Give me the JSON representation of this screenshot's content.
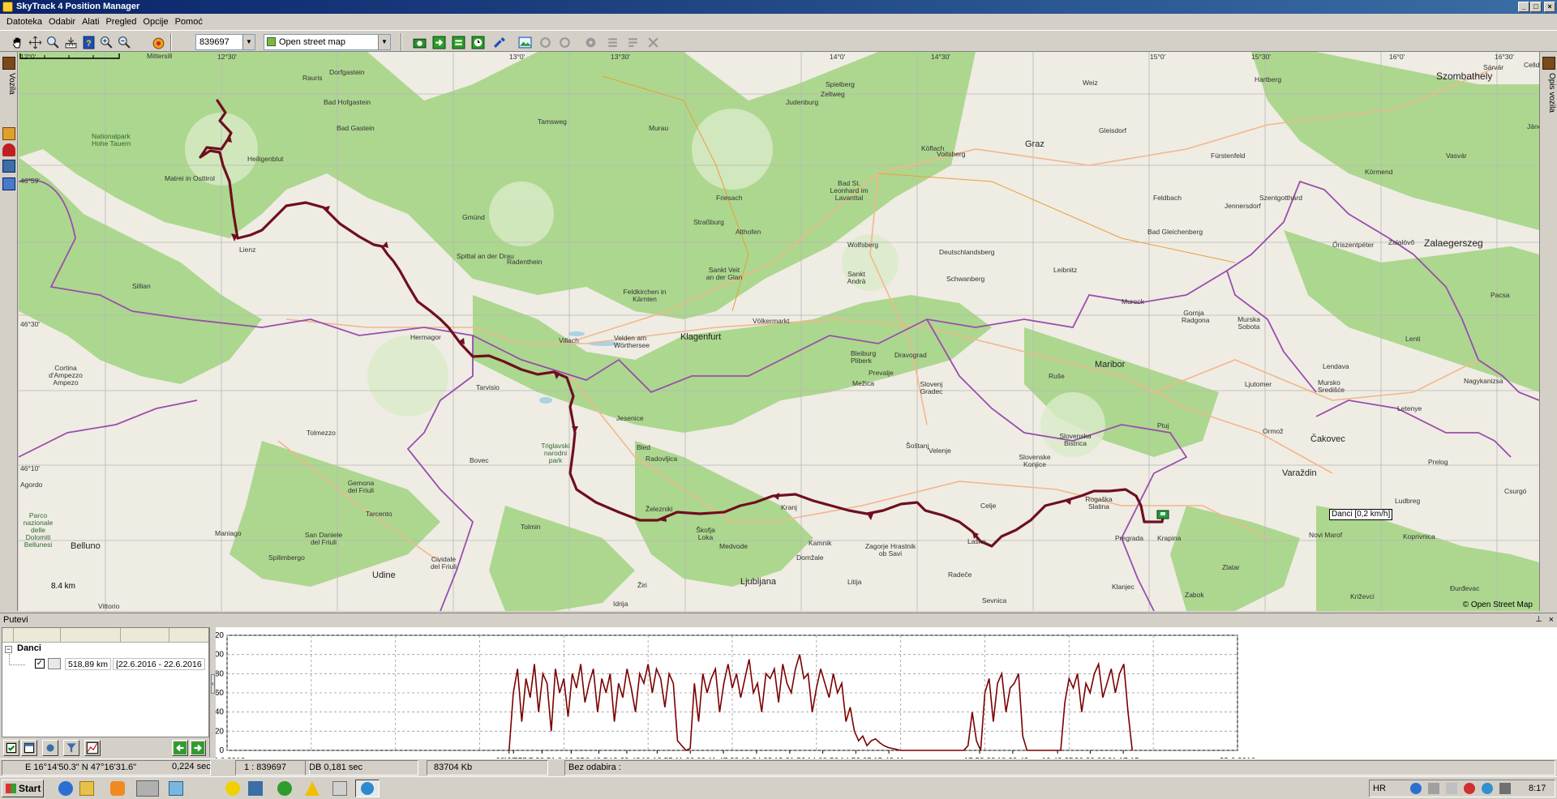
{
  "window": {
    "title": "SkyTrack 4 Position Manager"
  },
  "menu": [
    "Datoteka",
    "Odabir",
    "Alati",
    "Pregled",
    "Opcije",
    "Pomoć"
  ],
  "toolbar": {
    "scale_prefix": "1 :",
    "scale_value": "839697",
    "map_source": "Open street map"
  },
  "left_tabs": {
    "vehicles": "Vozila"
  },
  "right_tabs": {
    "vehicle_desc": "Opis vozila"
  },
  "map": {
    "grid_labels": [
      "12°0'",
      "12°30'",
      "13°0'",
      "13°30'",
      "14°0'",
      "14°30'",
      "15°0'",
      "15°30'",
      "16°0'",
      "16°30'",
      "46°59'",
      "46°30'",
      "46°10'"
    ],
    "places": [
      {
        "n": "Mittersill",
        "s": ""
      },
      {
        "n": "Dorfgastein",
        "s": ""
      },
      {
        "n": "Bad Hofgastein",
        "s": ""
      },
      {
        "n": "Bad Gastein",
        "s": ""
      },
      {
        "n": "Rauris",
        "s": ""
      },
      {
        "n": "Nationalpark Hohe Tauern",
        "s": ""
      },
      {
        "n": "Matrei in Osttirol",
        "s": ""
      },
      {
        "n": "Heiligenblut",
        "s": ""
      },
      {
        "n": "Lienz",
        "s": ""
      },
      {
        "n": "Sillian",
        "s": ""
      },
      {
        "n": "Gmünd",
        "s": ""
      },
      {
        "n": "Spittal an der Drau",
        "s": ""
      },
      {
        "n": "Radenthein",
        "s": ""
      },
      {
        "n": "Tamsweg",
        "s": ""
      },
      {
        "n": "Murau",
        "s": ""
      },
      {
        "n": "Judenburg",
        "s": ""
      },
      {
        "n": "Spielberg",
        "s": ""
      },
      {
        "n": "Zeltweg",
        "s": ""
      },
      {
        "n": "Friesach",
        "s": ""
      },
      {
        "n": "Straßburg",
        "s": ""
      },
      {
        "n": "Althofen",
        "s": ""
      },
      {
        "n": "Sankt Veit an der Glan",
        "s": ""
      },
      {
        "n": "Feldkirchen in Kärnten",
        "s": ""
      },
      {
        "n": "Villach",
        "s": ""
      },
      {
        "n": "Velden am Wörthersee",
        "s": ""
      },
      {
        "n": "Klagenfurt",
        "s": "big"
      },
      {
        "n": "Völkermarkt",
        "s": ""
      },
      {
        "n": "Wolfsberg",
        "s": ""
      },
      {
        "n": "Bad St. Leonhard im Lavanttal",
        "s": ""
      },
      {
        "n": "Sankt Andrä",
        "s": ""
      },
      {
        "n": "Köflach",
        "s": ""
      },
      {
        "n": "Voitsberg",
        "s": ""
      },
      {
        "n": "Graz",
        "s": "big"
      },
      {
        "n": "Gleisdorf",
        "s": ""
      },
      {
        "n": "Weiz",
        "s": ""
      },
      {
        "n": "Hartberg",
        "s": ""
      },
      {
        "n": "Fürstenfeld",
        "s": ""
      },
      {
        "n": "Feldbach",
        "s": ""
      },
      {
        "n": "Bad Gleichenberg",
        "s": ""
      },
      {
        "n": "Jennersdorf",
        "s": ""
      },
      {
        "n": "Szentgotthárd",
        "s": ""
      },
      {
        "n": "Szombathely",
        "s": "bigger"
      },
      {
        "n": "Sárvár",
        "s": ""
      },
      {
        "n": "Vasvár",
        "s": ""
      },
      {
        "n": "Körmend",
        "s": ""
      },
      {
        "n": "Zalaegerszeg",
        "s": "bigger"
      },
      {
        "n": "Zalalövő",
        "s": ""
      },
      {
        "n": "Deutschlandsberg",
        "s": ""
      },
      {
        "n": "Schwanberg",
        "s": ""
      },
      {
        "n": "Leibnitz",
        "s": ""
      },
      {
        "n": "Mureck",
        "s": ""
      },
      {
        "n": "Gornja Radgona",
        "s": ""
      },
      {
        "n": "Murska Sobota",
        "s": ""
      },
      {
        "n": "Lendava",
        "s": ""
      },
      {
        "n": "Mursko Središće",
        "s": ""
      },
      {
        "n": "Letenye",
        "s": ""
      },
      {
        "n": "Nagykanizsa",
        "s": ""
      },
      {
        "n": "Čakovec",
        "s": "big"
      },
      {
        "n": "Varaždin",
        "s": "big"
      },
      {
        "n": "Ljutomer",
        "s": ""
      },
      {
        "n": "Ormož",
        "s": ""
      },
      {
        "n": "Ptuj",
        "s": ""
      },
      {
        "n": "Maribor",
        "s": "big"
      },
      {
        "n": "Ruše",
        "s": ""
      },
      {
        "n": "Slovenska Bistrica",
        "s": ""
      },
      {
        "n": "Dravograd",
        "s": ""
      },
      {
        "n": "Bleiburg Pliberk",
        "s": ""
      },
      {
        "n": "Prevalje",
        "s": ""
      },
      {
        "n": "Mežica",
        "s": ""
      },
      {
        "n": "Slovenj Gradec",
        "s": ""
      },
      {
        "n": "Velenje",
        "s": ""
      },
      {
        "n": "Šoštanj",
        "s": ""
      },
      {
        "n": "Slovenske Konjice",
        "s": ""
      },
      {
        "n": "Celje",
        "s": ""
      },
      {
        "n": "Rogaška Slatina",
        "s": ""
      },
      {
        "n": "Pregrada",
        "s": ""
      },
      {
        "n": "Krapina",
        "s": ""
      },
      {
        "n": "Zabok",
        "s": ""
      },
      {
        "n": "Zlatar",
        "s": ""
      },
      {
        "n": "Novi Marof",
        "s": ""
      },
      {
        "n": "Ludbreg",
        "s": ""
      },
      {
        "n": "Koprivnica",
        "s": ""
      },
      {
        "n": "Križevci",
        "s": ""
      },
      {
        "n": "Đurđevac",
        "s": ""
      },
      {
        "n": "Hermagor",
        "s": ""
      },
      {
        "n": "Tarvisio",
        "s": ""
      },
      {
        "n": "Jesenice",
        "s": ""
      },
      {
        "n": "Bled",
        "s": ""
      },
      {
        "n": "Radovljica",
        "s": ""
      },
      {
        "n": "Kranj",
        "s": ""
      },
      {
        "n": "Kamnik",
        "s": ""
      },
      {
        "n": "Domžale",
        "s": ""
      },
      {
        "n": "Medvode",
        "s": ""
      },
      {
        "n": "Škofja Loka",
        "s": ""
      },
      {
        "n": "Ljubljana",
        "s": "big"
      },
      {
        "n": "Litija",
        "s": ""
      },
      {
        "n": "Zagorje Hrastnik ob Savi",
        "s": ""
      },
      {
        "n": "Laško",
        "s": ""
      },
      {
        "n": "Radeče",
        "s": ""
      },
      {
        "n": "Sevnica",
        "s": ""
      },
      {
        "n": "Klanjec",
        "s": ""
      },
      {
        "n": "Železniki",
        "s": ""
      },
      {
        "n": "Idrija",
        "s": ""
      },
      {
        "n": "Žiri",
        "s": ""
      },
      {
        "n": "Triglavski narodni park",
        "s": ""
      },
      {
        "n": "Bovec",
        "s": ""
      },
      {
        "n": "Tolmezzo",
        "s": ""
      },
      {
        "n": "Gemona del Friuli",
        "s": ""
      },
      {
        "n": "Tolmin",
        "s": ""
      },
      {
        "n": "Tarcento",
        "s": ""
      },
      {
        "n": "Cividale del Friuli",
        "s": ""
      },
      {
        "n": "Udine",
        "s": "big"
      },
      {
        "n": "San Daniele del Friuli",
        "s": ""
      },
      {
        "n": "Maniago",
        "s": ""
      },
      {
        "n": "Spilimbergo",
        "s": ""
      },
      {
        "n": "Cortina d'Ampezzo Ampezo",
        "s": ""
      },
      {
        "n": "Agordo",
        "s": ""
      },
      {
        "n": "Parco nazionale delle Dolomiti Bellunesi",
        "s": ""
      },
      {
        "n": "Belluno",
        "s": "big"
      },
      {
        "n": "Vittorio",
        "s": ""
      },
      {
        "n": "Lenti",
        "s": ""
      },
      {
        "n": "Pacsa",
        "s": ""
      },
      {
        "n": "Őriszentpéter",
        "s": ""
      },
      {
        "n": "Prelog",
        "s": ""
      },
      {
        "n": "Csurgó",
        "s": ""
      },
      {
        "n": "Jánosháza",
        "s": ""
      },
      {
        "n": "Celldömölk",
        "s": ""
      }
    ],
    "scale_label": "8.4 km",
    "copyright": "© Open Street Map",
    "vehicle_label": "Danci [0,2 km/h]"
  },
  "panel": {
    "title": "Putevi",
    "pin": "⊥",
    "close": "×"
  },
  "tree": {
    "group": "Danci",
    "route_distance": "518,89 km",
    "route_dates": "[22.6.2016 - 22.6.2016"
  },
  "chart_data": {
    "type": "line",
    "title": "",
    "xlabel": "",
    "ylabel": "",
    "ylim": [
      0,
      120
    ],
    "yticks": [
      0,
      20,
      40,
      60,
      80,
      100,
      120
    ],
    "xlim": [
      "22.6.2016 00:00",
      "23.6.2016 00:00"
    ],
    "x_edge_labels": [
      "22.6.2016",
      "23.6.2016"
    ],
    "xtick_labels": [
      "6:41:55",
      "6:48:15",
      "7:28:51",
      "8:10:25",
      "8:49:54",
      "9:29:43",
      "10:12:55",
      "11:00:09",
      "11:47:23",
      "12:34:33",
      "13:21:56",
      "14:08:56",
      "14:56:05",
      "15:43:11",
      "17:52:33",
      "18:39:43",
      "19:43:35",
      "20:30:06",
      "21:17:15"
    ],
    "series_color": "#7b0000",
    "series": [
      {
        "name": "",
        "x_hours": [
          6.7,
          6.8,
          6.9,
          7.0,
          7.1,
          7.2,
          7.3,
          7.4,
          7.5,
          7.6,
          7.7,
          7.8,
          7.9,
          8.0,
          8.1,
          8.2,
          8.3,
          8.4,
          8.5,
          8.6,
          8.7,
          8.8,
          8.9,
          9.0,
          9.1,
          9.2,
          9.3,
          9.4,
          9.5,
          9.6,
          9.7,
          9.8,
          9.9,
          10.0,
          10.1,
          10.2,
          10.3,
          10.4,
          10.5,
          10.6,
          10.7,
          10.8,
          10.9,
          11.0,
          11.1,
          11.2,
          11.3,
          11.4,
          11.5,
          11.6,
          11.7,
          11.8,
          11.9,
          12.0,
          12.1,
          12.2,
          12.3,
          12.4,
          12.5,
          12.6,
          12.7,
          12.8,
          12.9,
          13.0,
          13.1,
          13.2,
          13.3,
          13.4,
          13.5,
          13.6,
          13.7,
          13.8,
          13.9,
          14.0,
          14.1,
          14.2,
          14.3,
          14.4,
          14.5,
          14.6,
          14.7,
          14.8,
          14.9,
          15.0,
          15.1,
          15.2,
          15.3,
          15.4,
          15.5,
          15.6,
          15.7,
          15.8,
          15.9,
          16.0,
          16.5,
          17.0,
          17.5,
          17.6,
          17.7,
          17.8,
          17.9,
          18.0,
          18.1,
          18.2,
          18.3,
          18.4,
          18.5,
          18.6,
          18.7,
          18.8,
          18.9,
          19.0,
          19.5,
          19.7,
          19.8,
          19.9,
          20.0,
          20.1,
          20.2,
          20.3,
          20.4,
          20.5,
          20.6,
          20.7,
          20.8,
          20.9,
          21.0,
          21.1,
          21.2,
          21.3,
          21.4,
          21.5
        ],
        "y": [
          0,
          60,
          85,
          30,
          75,
          55,
          90,
          40,
          80,
          70,
          20,
          85,
          60,
          75,
          35,
          80,
          65,
          90,
          50,
          70,
          85,
          40,
          75,
          60,
          80,
          30,
          70,
          55,
          85,
          65,
          40,
          80,
          70,
          90,
          60,
          85,
          75,
          45,
          80,
          70,
          10,
          5,
          0,
          2,
          70,
          30,
          80,
          60,
          75,
          85,
          40,
          70,
          90,
          65,
          80,
          55,
          75,
          95,
          60,
          70,
          40,
          80,
          75,
          85,
          50,
          90,
          70,
          60,
          85,
          100,
          75,
          80,
          40,
          65,
          85,
          70,
          55,
          80,
          60,
          70,
          30,
          45,
          20,
          10,
          15,
          5,
          10,
          12,
          8,
          5,
          3,
          2,
          1,
          0,
          0,
          0,
          0,
          5,
          40,
          10,
          0,
          60,
          75,
          30,
          70,
          80,
          40,
          65,
          70,
          80,
          15,
          0,
          0,
          0,
          0,
          50,
          75,
          65,
          80,
          40,
          70,
          60,
          80,
          90,
          55,
          70,
          85,
          60,
          80,
          90,
          40,
          0
        ]
      }
    ]
  },
  "status": {
    "coords": "E 16°14'50.3\" N 47°16'31.6\"",
    "time1": "0,224 sec",
    "scale": "1 : 839697",
    "db": "DB 0,181 sec",
    "mem": "83704 Kb",
    "selection": "Bez odabira :"
  },
  "taskbar": {
    "start": "Start",
    "lang": "HR",
    "clock": "8:17"
  }
}
